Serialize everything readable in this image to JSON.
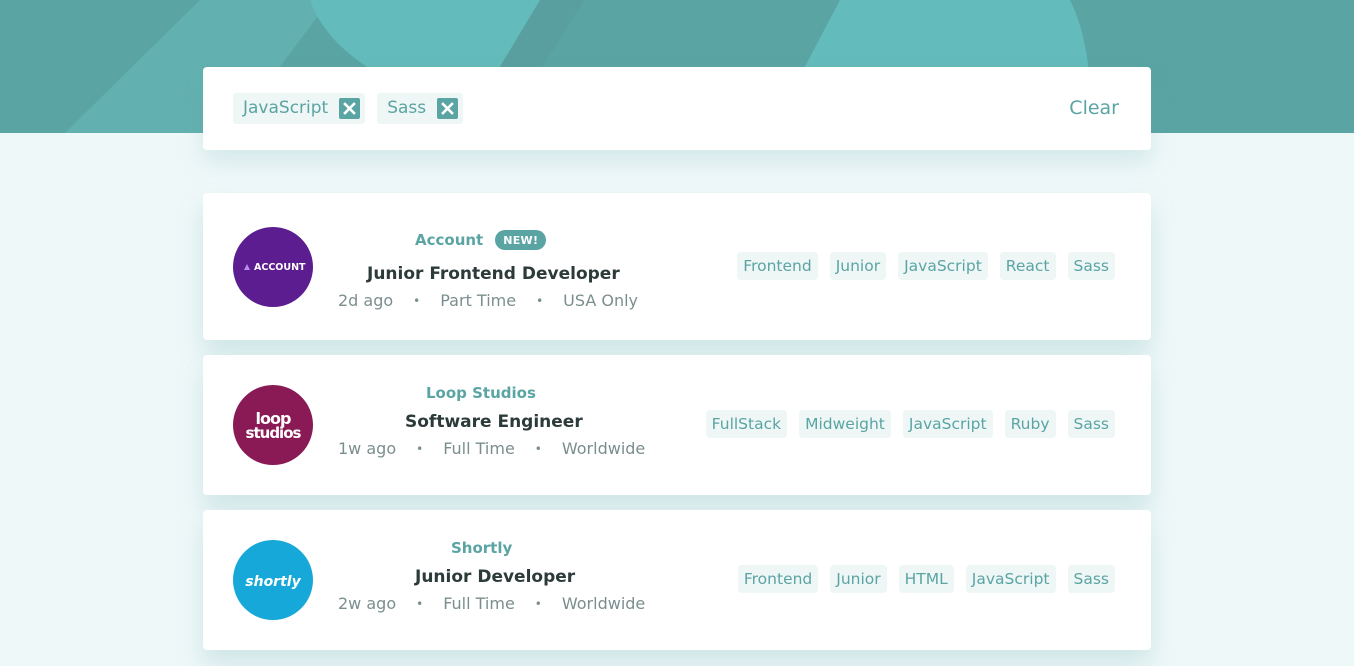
{
  "filters": {
    "active": [
      "JavaScript",
      "Sass"
    ],
    "clear_label": "Clear",
    "remove_icon": "close-icon"
  },
  "colors": {
    "primary": "#5ba4a4",
    "background": "#eff8f9",
    "tag_background": "#eef6f6",
    "dark_text": "#2c3a3a",
    "gray_text": "#7b8e8e"
  },
  "jobs": [
    {
      "company": "Account",
      "badge": "NEW!",
      "logo_text": "ACCOUNT",
      "position": "Junior Frontend Developer",
      "posted": "2d ago",
      "contract": "Part Time",
      "location": "USA Only",
      "tags": [
        "Frontend",
        "Junior",
        "JavaScript",
        "React",
        "Sass"
      ]
    },
    {
      "company": "Loop Studios",
      "logo_text": [
        "loop",
        "studios"
      ],
      "position": "Software Engineer",
      "posted": "1w ago",
      "contract": "Full Time",
      "location": "Worldwide",
      "tags": [
        "FullStack",
        "Midweight",
        "JavaScript",
        "Ruby",
        "Sass"
      ]
    },
    {
      "company": "Shortly",
      "logo_text": "shortly",
      "position": "Junior Developer",
      "posted": "2w ago",
      "contract": "Full Time",
      "location": "Worldwide",
      "tags": [
        "Frontend",
        "Junior",
        "HTML",
        "JavaScript",
        "Sass"
      ]
    }
  ],
  "separator": "•"
}
